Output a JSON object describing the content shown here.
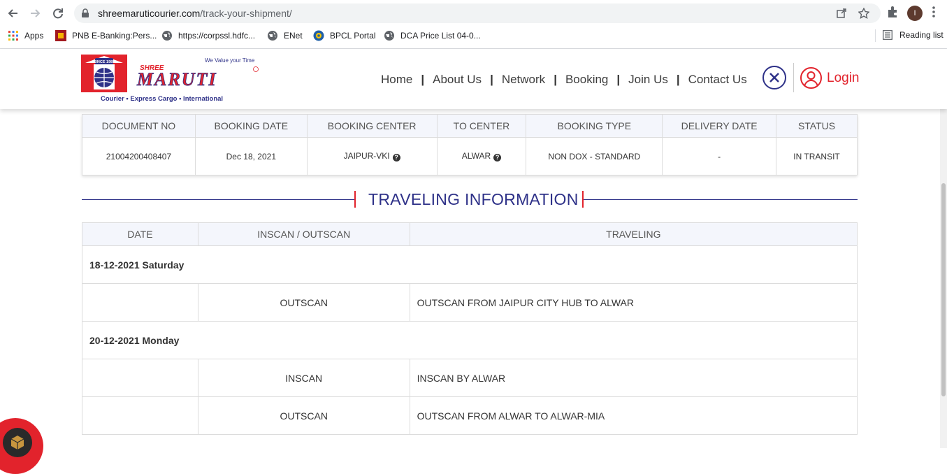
{
  "browser": {
    "url_host": "shreemaruticourier.com",
    "url_path": "/track-your-shipment/",
    "profile_initial": "I",
    "bookmarks": [
      {
        "label": "Apps",
        "icon": "apps-grid-icon"
      },
      {
        "label": "PNB E-Banking:Pers...",
        "icon": "pnb-icon"
      },
      {
        "label": "https://corpssl.hdfc...",
        "icon": "globe-icon"
      },
      {
        "label": "ENet",
        "icon": "globe-icon"
      },
      {
        "label": "BPCL Portal",
        "icon": "bpcl-icon"
      },
      {
        "label": "DCA Price List 04-0...",
        "icon": "globe-icon"
      }
    ],
    "reading_list": "Reading list"
  },
  "header": {
    "logo": {
      "tagline_top": "We Value your Time",
      "since": "SINCE 1985",
      "brand_small": "SHREE",
      "brand": "MARUTI",
      "tagline_bottom": "Courier • Express Cargo • International"
    },
    "nav": [
      "Home",
      "About Us",
      "Network",
      "Booking",
      "Join Us",
      "Contact Us"
    ],
    "nav_sep": "|",
    "login": "Login"
  },
  "shipment": {
    "headers": [
      "DOCUMENT NO",
      "BOOKING DATE",
      "BOOKING CENTER",
      "TO CENTER",
      "BOOKING TYPE",
      "DELIVERY DATE",
      "STATUS"
    ],
    "row": {
      "document_no": "21004200408407",
      "booking_date": "Dec 18, 2021",
      "booking_center": "JAIPUR-VKI",
      "to_center": "ALWAR",
      "booking_type": "NON DOX - STANDARD",
      "delivery_date": "-",
      "status": "IN TRANSIT"
    }
  },
  "traveling": {
    "title": "TRAVELING INFORMATION",
    "headers": [
      "DATE",
      "INSCAN / OUTSCAN",
      "TRAVELING"
    ],
    "groups": [
      {
        "date": "18-12-2021 Saturday",
        "rows": [
          {
            "scan": "OUTSCAN",
            "info": "OUTSCAN FROM JAIPUR CITY HUB TO ALWAR"
          }
        ]
      },
      {
        "date": "20-12-2021 Monday",
        "rows": [
          {
            "scan": "INSCAN",
            "info": "INSCAN BY ALWAR"
          },
          {
            "scan": "OUTSCAN",
            "info": "OUTSCAN FROM ALWAR TO ALWAR-MIA"
          }
        ]
      }
    ]
  },
  "colors": {
    "brand_blue": "#2e3188",
    "brand_red": "#e2232c",
    "table_header_bg": "#f4f6fc"
  }
}
